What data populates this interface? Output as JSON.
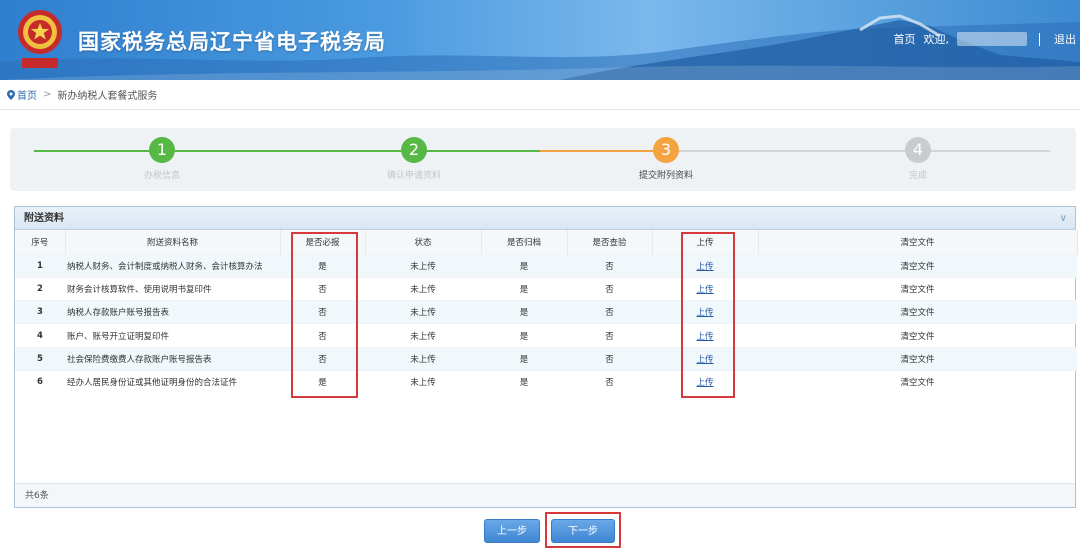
{
  "header": {
    "site_title": "国家税务总局辽宁省电子税务局",
    "home_link": "首页",
    "welcome": "欢迎,",
    "logout": "退出",
    "emblem_icon": "tax-emblem"
  },
  "breadcrumb": {
    "home": "首页",
    "separator": ">",
    "current": "新办纳税人套餐式服务"
  },
  "stepper": {
    "steps": [
      {
        "num": "1",
        "label": "办税信息",
        "state": "done",
        "color": "#56b945"
      },
      {
        "num": "2",
        "label": "确认申请资料",
        "state": "done",
        "color": "#56b945"
      },
      {
        "num": "3",
        "label": "提交附列资料",
        "state": "active",
        "color": "#f4a340"
      },
      {
        "num": "4",
        "label": "完成",
        "state": "pending",
        "color": "#c9ccce"
      }
    ]
  },
  "panel": {
    "title": "附送资料",
    "toggle_icon": "chevron-down-icon",
    "columns": [
      "序号",
      "附送资料名称",
      "是否必报",
      "状态",
      "是否归档",
      "是否查验",
      "上传",
      "清空文件"
    ],
    "rows": [
      {
        "idx": "1",
        "name": "纳税人财务、会计制度或纳税人财务、会计核算办法",
        "required": "是",
        "status": "未上传",
        "archive": "是",
        "verify": "否",
        "upload": "上传",
        "clear": "清空文件"
      },
      {
        "idx": "2",
        "name": "财务会计核算软件、使用说明书复印件",
        "required": "否",
        "status": "未上传",
        "archive": "是",
        "verify": "否",
        "upload": "上传",
        "clear": "清空文件"
      },
      {
        "idx": "3",
        "name": "纳税人存款账户账号报告表",
        "required": "否",
        "status": "未上传",
        "archive": "是",
        "verify": "否",
        "upload": "上传",
        "clear": "清空文件"
      },
      {
        "idx": "4",
        "name": "账户、账号开立证明复印件",
        "required": "否",
        "status": "未上传",
        "archive": "是",
        "verify": "否",
        "upload": "上传",
        "clear": "清空文件"
      },
      {
        "idx": "5",
        "name": "社会保险费缴费人存款账户账号报告表",
        "required": "否",
        "status": "未上传",
        "archive": "是",
        "verify": "否",
        "upload": "上传",
        "clear": "清空文件"
      },
      {
        "idx": "6",
        "name": "经办人居民身份证或其他证明身份的合法证件",
        "required": "是",
        "status": "未上传",
        "archive": "是",
        "verify": "否",
        "upload": "上传",
        "clear": "清空文件"
      }
    ],
    "footer": "共6条"
  },
  "buttons": {
    "prev": "上一步",
    "next": "下一步"
  },
  "colors": {
    "header_blue": "#3d8bd2",
    "done_green": "#56b945",
    "active_orange": "#f4a340",
    "highlight_red": "#d4393b",
    "link_blue": "#2458a6"
  }
}
